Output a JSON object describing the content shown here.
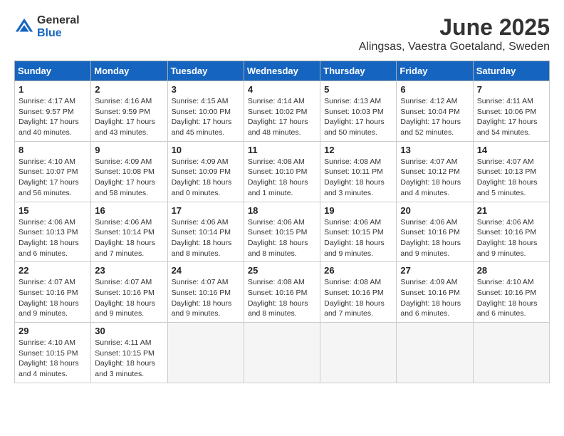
{
  "header": {
    "logo_general": "General",
    "logo_blue": "Blue",
    "month": "June 2025",
    "location": "Alingsas, Vaestra Goetaland, Sweden"
  },
  "days_of_week": [
    "Sunday",
    "Monday",
    "Tuesday",
    "Wednesday",
    "Thursday",
    "Friday",
    "Saturday"
  ],
  "weeks": [
    [
      {
        "day": "1",
        "info": "Sunrise: 4:17 AM\nSunset: 9:57 PM\nDaylight: 17 hours\nand 40 minutes."
      },
      {
        "day": "2",
        "info": "Sunrise: 4:16 AM\nSunset: 9:59 PM\nDaylight: 17 hours\nand 43 minutes."
      },
      {
        "day": "3",
        "info": "Sunrise: 4:15 AM\nSunset: 10:00 PM\nDaylight: 17 hours\nand 45 minutes."
      },
      {
        "day": "4",
        "info": "Sunrise: 4:14 AM\nSunset: 10:02 PM\nDaylight: 17 hours\nand 48 minutes."
      },
      {
        "day": "5",
        "info": "Sunrise: 4:13 AM\nSunset: 10:03 PM\nDaylight: 17 hours\nand 50 minutes."
      },
      {
        "day": "6",
        "info": "Sunrise: 4:12 AM\nSunset: 10:04 PM\nDaylight: 17 hours\nand 52 minutes."
      },
      {
        "day": "7",
        "info": "Sunrise: 4:11 AM\nSunset: 10:06 PM\nDaylight: 17 hours\nand 54 minutes."
      }
    ],
    [
      {
        "day": "8",
        "info": "Sunrise: 4:10 AM\nSunset: 10:07 PM\nDaylight: 17 hours\nand 56 minutes."
      },
      {
        "day": "9",
        "info": "Sunrise: 4:09 AM\nSunset: 10:08 PM\nDaylight: 17 hours\nand 58 minutes."
      },
      {
        "day": "10",
        "info": "Sunrise: 4:09 AM\nSunset: 10:09 PM\nDaylight: 18 hours\nand 0 minutes."
      },
      {
        "day": "11",
        "info": "Sunrise: 4:08 AM\nSunset: 10:10 PM\nDaylight: 18 hours\nand 1 minute."
      },
      {
        "day": "12",
        "info": "Sunrise: 4:08 AM\nSunset: 10:11 PM\nDaylight: 18 hours\nand 3 minutes."
      },
      {
        "day": "13",
        "info": "Sunrise: 4:07 AM\nSunset: 10:12 PM\nDaylight: 18 hours\nand 4 minutes."
      },
      {
        "day": "14",
        "info": "Sunrise: 4:07 AM\nSunset: 10:13 PM\nDaylight: 18 hours\nand 5 minutes."
      }
    ],
    [
      {
        "day": "15",
        "info": "Sunrise: 4:06 AM\nSunset: 10:13 PM\nDaylight: 18 hours\nand 6 minutes."
      },
      {
        "day": "16",
        "info": "Sunrise: 4:06 AM\nSunset: 10:14 PM\nDaylight: 18 hours\nand 7 minutes."
      },
      {
        "day": "17",
        "info": "Sunrise: 4:06 AM\nSunset: 10:14 PM\nDaylight: 18 hours\nand 8 minutes."
      },
      {
        "day": "18",
        "info": "Sunrise: 4:06 AM\nSunset: 10:15 PM\nDaylight: 18 hours\nand 8 minutes."
      },
      {
        "day": "19",
        "info": "Sunrise: 4:06 AM\nSunset: 10:15 PM\nDaylight: 18 hours\nand 9 minutes."
      },
      {
        "day": "20",
        "info": "Sunrise: 4:06 AM\nSunset: 10:16 PM\nDaylight: 18 hours\nand 9 minutes."
      },
      {
        "day": "21",
        "info": "Sunrise: 4:06 AM\nSunset: 10:16 PM\nDaylight: 18 hours\nand 9 minutes."
      }
    ],
    [
      {
        "day": "22",
        "info": "Sunrise: 4:07 AM\nSunset: 10:16 PM\nDaylight: 18 hours\nand 9 minutes."
      },
      {
        "day": "23",
        "info": "Sunrise: 4:07 AM\nSunset: 10:16 PM\nDaylight: 18 hours\nand 9 minutes."
      },
      {
        "day": "24",
        "info": "Sunrise: 4:07 AM\nSunset: 10:16 PM\nDaylight: 18 hours\nand 9 minutes."
      },
      {
        "day": "25",
        "info": "Sunrise: 4:08 AM\nSunset: 10:16 PM\nDaylight: 18 hours\nand 8 minutes."
      },
      {
        "day": "26",
        "info": "Sunrise: 4:08 AM\nSunset: 10:16 PM\nDaylight: 18 hours\nand 7 minutes."
      },
      {
        "day": "27",
        "info": "Sunrise: 4:09 AM\nSunset: 10:16 PM\nDaylight: 18 hours\nand 6 minutes."
      },
      {
        "day": "28",
        "info": "Sunrise: 4:10 AM\nSunset: 10:16 PM\nDaylight: 18 hours\nand 6 minutes."
      }
    ],
    [
      {
        "day": "29",
        "info": "Sunrise: 4:10 AM\nSunset: 10:15 PM\nDaylight: 18 hours\nand 4 minutes."
      },
      {
        "day": "30",
        "info": "Sunrise: 4:11 AM\nSunset: 10:15 PM\nDaylight: 18 hours\nand 3 minutes."
      },
      {
        "day": "",
        "info": ""
      },
      {
        "day": "",
        "info": ""
      },
      {
        "day": "",
        "info": ""
      },
      {
        "day": "",
        "info": ""
      },
      {
        "day": "",
        "info": ""
      }
    ]
  ]
}
